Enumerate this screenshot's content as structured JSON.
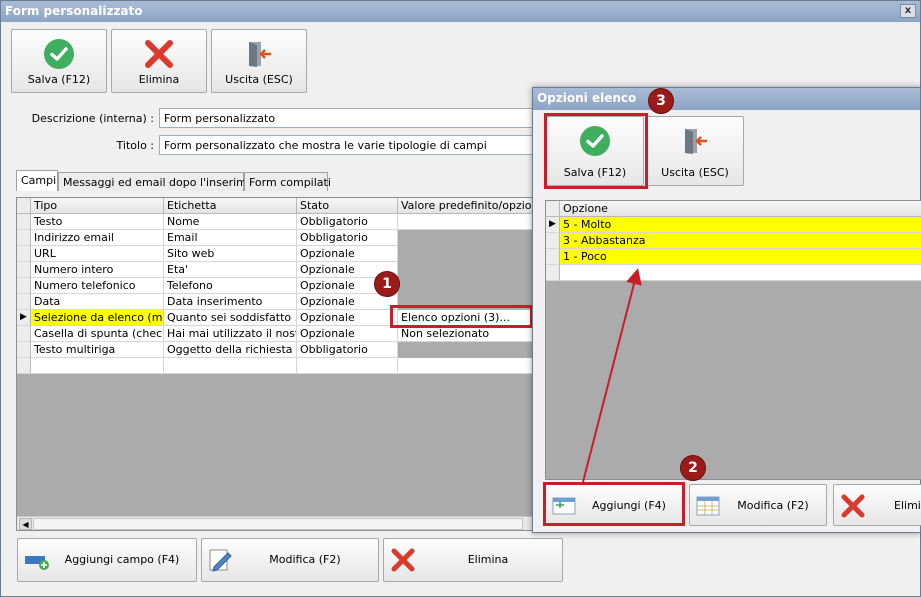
{
  "main_window": {
    "title": "Form personalizzato",
    "close": "x",
    "toolbar": {
      "save": "Salva (F12)",
      "delete": "Elimina",
      "exit": "Uscita (ESC)"
    },
    "fields": {
      "description_label": "Descrizione (interna) :",
      "description_value": "Form personalizzato",
      "title_label": "Titolo :",
      "title_value": "Form personalizzato che mostra le varie tipologie di campi"
    },
    "tabs": [
      "Campi",
      "Messaggi ed email dopo l'inserimento",
      "Form compilati"
    ],
    "grid": {
      "headers": [
        "Tipo",
        "Etichetta",
        "Stato",
        "Valore predefinito/opzioni"
      ],
      "rows": [
        {
          "tipo": "Testo",
          "etichetta": "Nome",
          "stato": "Obbligatorio",
          "valore": ""
        },
        {
          "tipo": "Indirizzo email",
          "etichetta": "Email",
          "stato": "Obbligatorio",
          "valore": ""
        },
        {
          "tipo": "URL",
          "etichetta": "Sito web",
          "stato": "Opzionale",
          "valore": ""
        },
        {
          "tipo": "Numero intero",
          "etichetta": "Eta'",
          "stato": "Opzionale",
          "valore": ""
        },
        {
          "tipo": "Numero telefonico",
          "etichetta": "Telefono",
          "stato": "Opzionale",
          "valore": ""
        },
        {
          "tipo": "Data",
          "etichetta": "Data inserimento",
          "stato": "Opzionale",
          "valore": ""
        },
        {
          "tipo": "Selezione da elenco (me...",
          "etichetta": "Quanto sei soddisfatto ...",
          "stato": "Opzionale",
          "valore": "Elenco opzioni (3)..."
        },
        {
          "tipo": "Casella di spunta (check...",
          "etichetta": "Hai mai utilizzato il nostr...",
          "stato": "Opzionale",
          "valore": "Non selezionato"
        },
        {
          "tipo": "Testo multiriga",
          "etichetta": "Oggetto della richiesta",
          "stato": "Obbligatorio",
          "valore": ""
        }
      ]
    },
    "bottom_buttons": {
      "add": "Aggiungi campo (F4)",
      "edit": "Modifica (F2)",
      "delete": "Elimina"
    }
  },
  "popup": {
    "title": "Opzioni elenco",
    "save": "Salva (F12)",
    "exit": "Uscita (ESC)",
    "header": "Opzione",
    "options": [
      "5 - Molto",
      "3 - Abbastanza",
      "1 - Poco"
    ],
    "add": "Aggiungi (F4)",
    "edit": "Modifica (F2)",
    "delete": "Elimina"
  },
  "annotations": [
    "1",
    "2",
    "3"
  ],
  "colors": {
    "highlight": "#ffff00",
    "annotation_red": "#c81e2a",
    "badge": "#9b1b1b",
    "check_green": "#3fae5e",
    "x_red": "#d93a2b"
  }
}
